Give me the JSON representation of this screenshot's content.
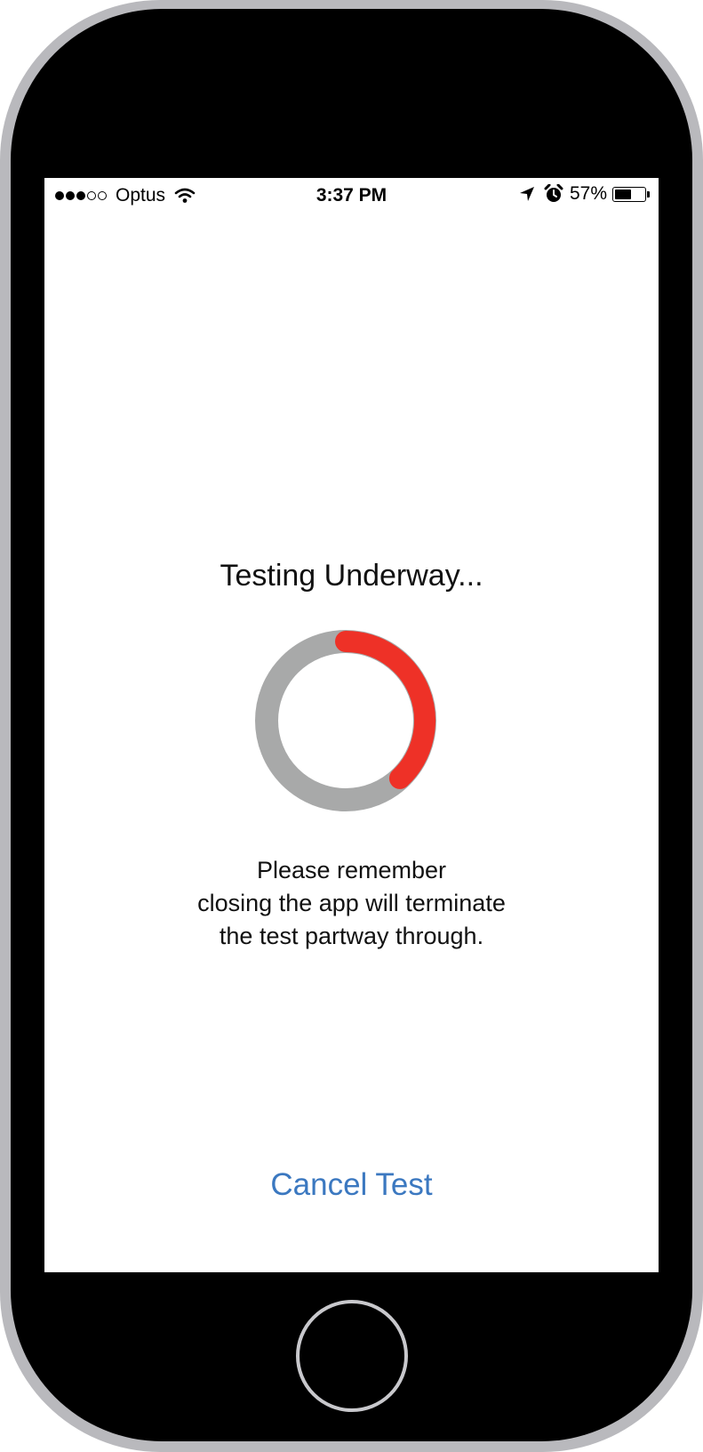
{
  "status_bar": {
    "signal_bars_filled": 3,
    "signal_bars_total": 5,
    "carrier": "Optus",
    "time": "3:37 PM",
    "battery_percent": "57%",
    "battery_level": 0.57,
    "icons": [
      "wifi-icon",
      "location-arrow-icon",
      "alarm-icon",
      "battery-icon"
    ]
  },
  "main": {
    "heading": "Testing Underway...",
    "progress_fraction": 0.38,
    "message_lines": [
      "Please remember",
      "closing the app will terminate",
      "the test partway through."
    ],
    "cancel_label": "Cancel Test"
  },
  "colors": {
    "progress_accent": "#ee3127",
    "progress_track": "#a8a9a9",
    "link": "#3b78c0"
  }
}
